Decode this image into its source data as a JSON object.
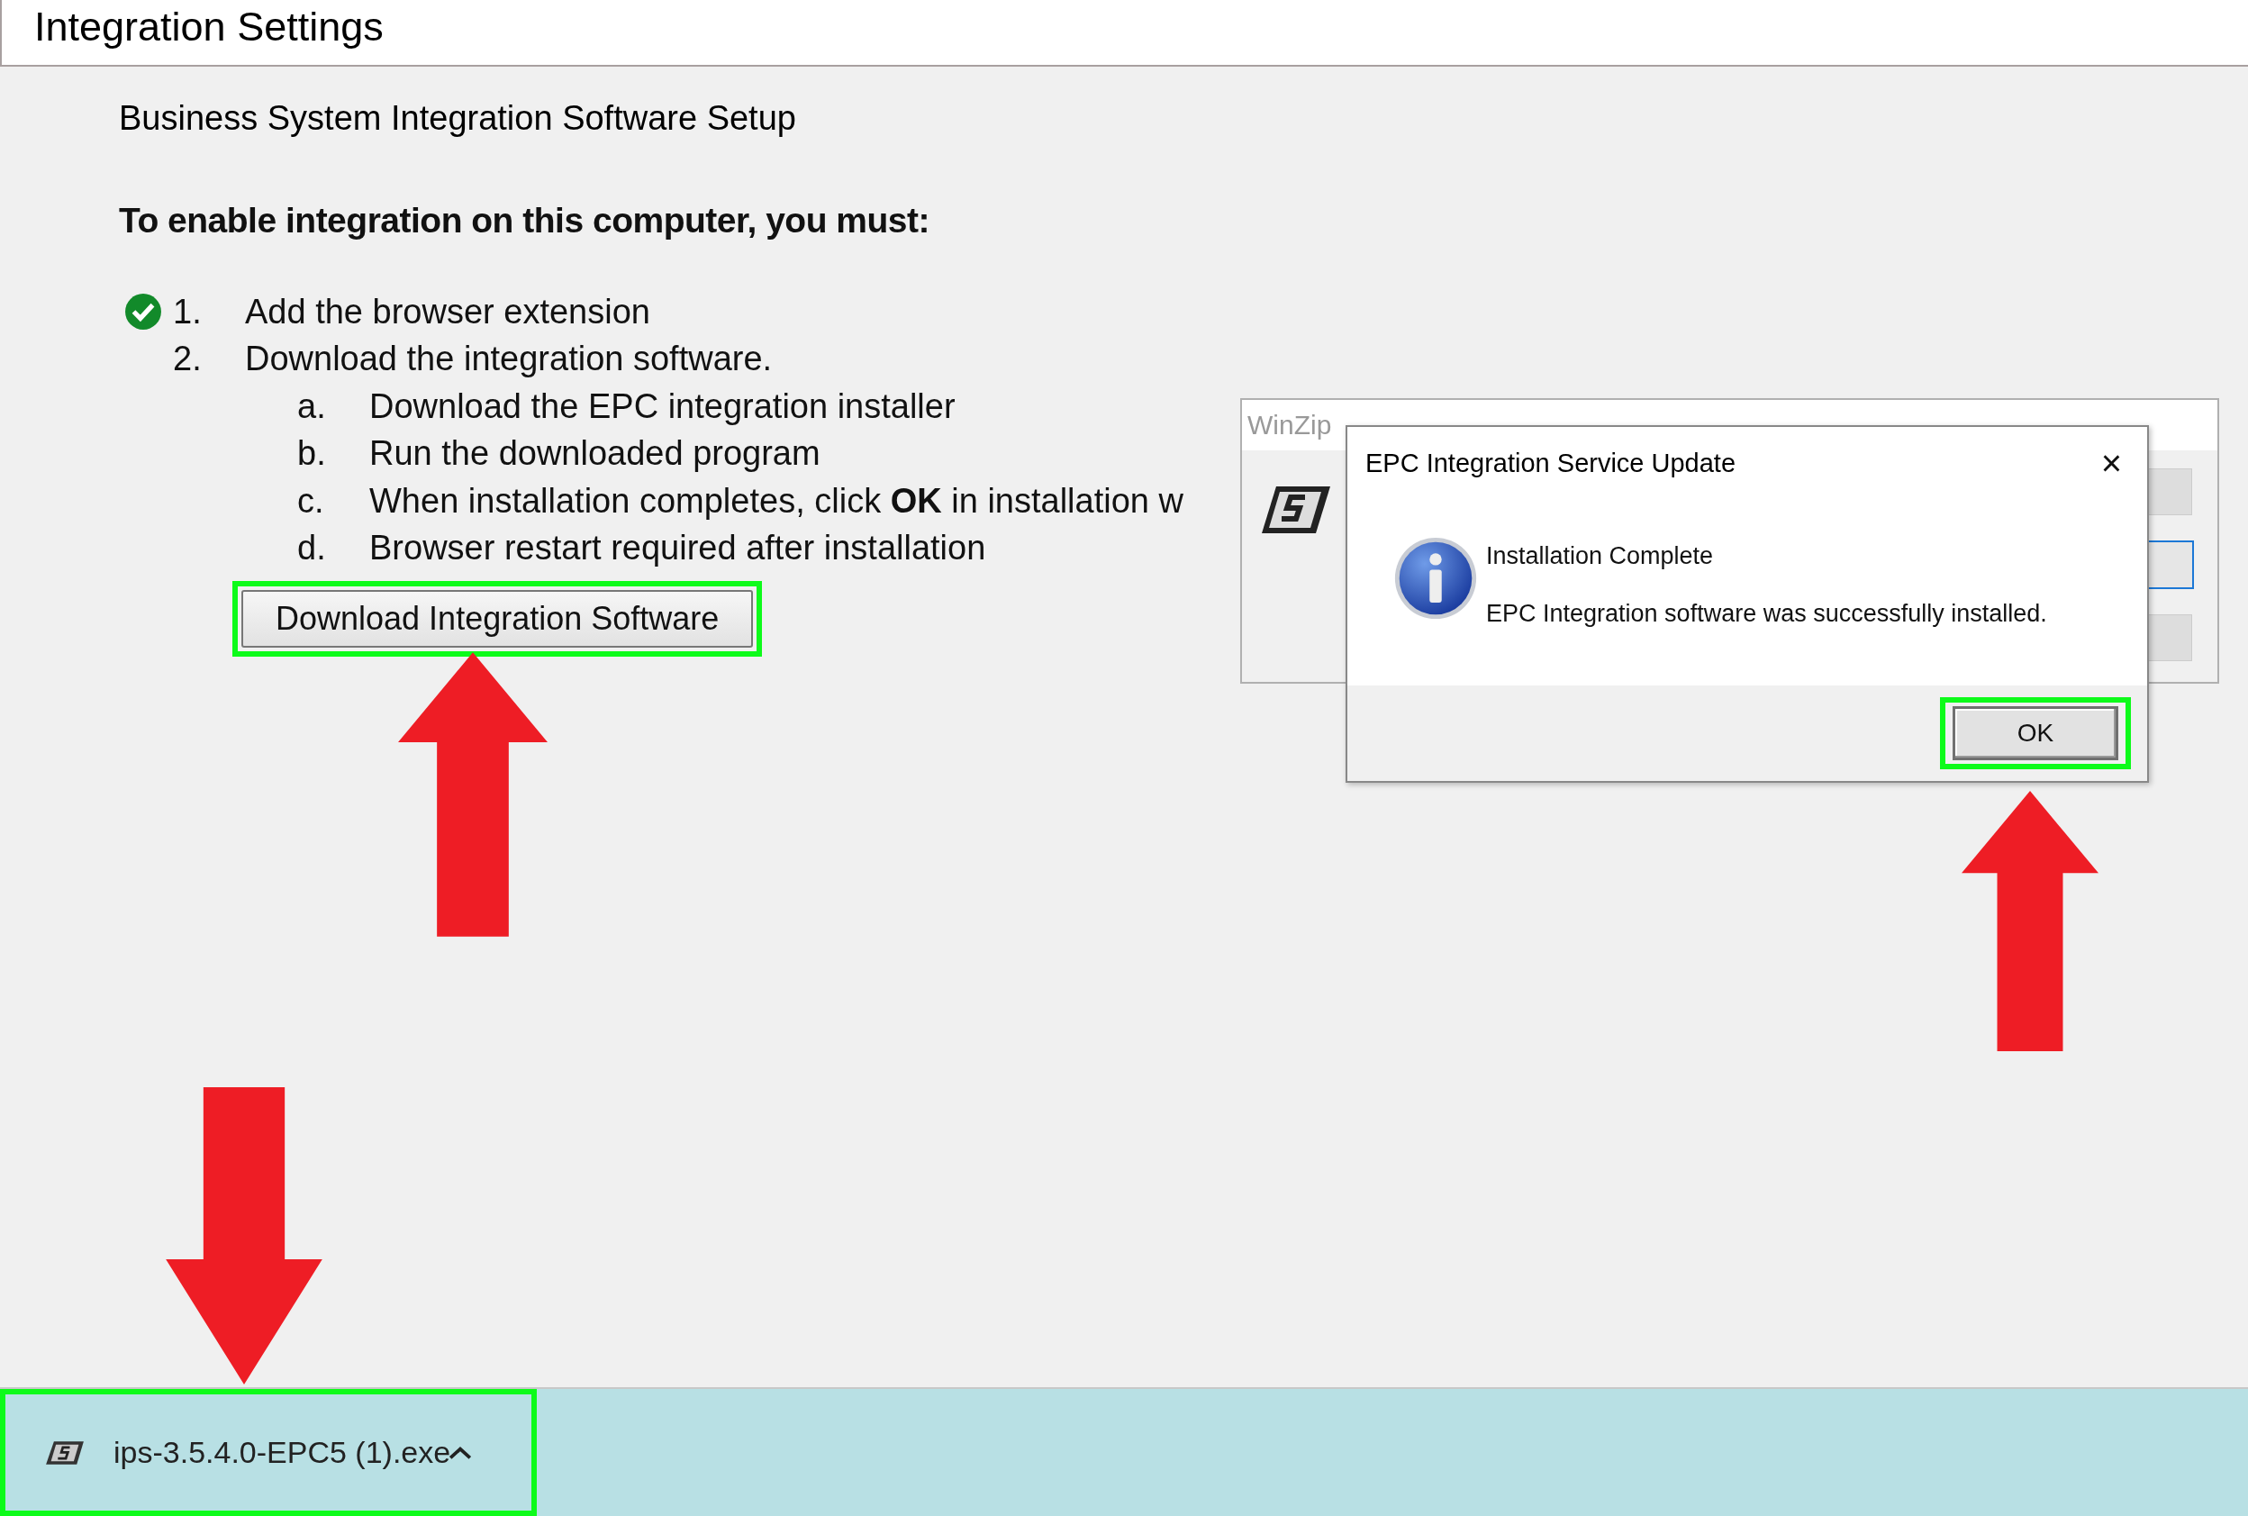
{
  "header": {
    "title": "Integration Settings"
  },
  "section_title": "Business System Integration Software Setup",
  "intro": "To enable integration on this computer, you must:",
  "steps": [
    {
      "number": "1.",
      "text": "Add the browser extension",
      "done": true
    },
    {
      "number": "2.",
      "text": "Download the integration software.",
      "done": false,
      "children": [
        {
          "number": "a.",
          "text": "Download the EPC integration installer"
        },
        {
          "number": "b.",
          "text": "Run the downloaded program"
        },
        {
          "number": "c.",
          "text": "When installation completes, click **OK** in installation w"
        },
        {
          "number": "d.",
          "text": "Browser restart required after installation"
        }
      ]
    }
  ],
  "download_button": {
    "label": "Download Integration Software"
  },
  "background_window": {
    "title": "WinZip"
  },
  "dialog": {
    "title": "EPC Integration Service Update",
    "close": "×",
    "heading": "Installation Complete",
    "message": "EPC Integration software was successfully installed.",
    "ok_button": "OK"
  },
  "download_bar": {
    "file_name": "ips-3.5.4.0-EPC5 (1).exe"
  }
}
